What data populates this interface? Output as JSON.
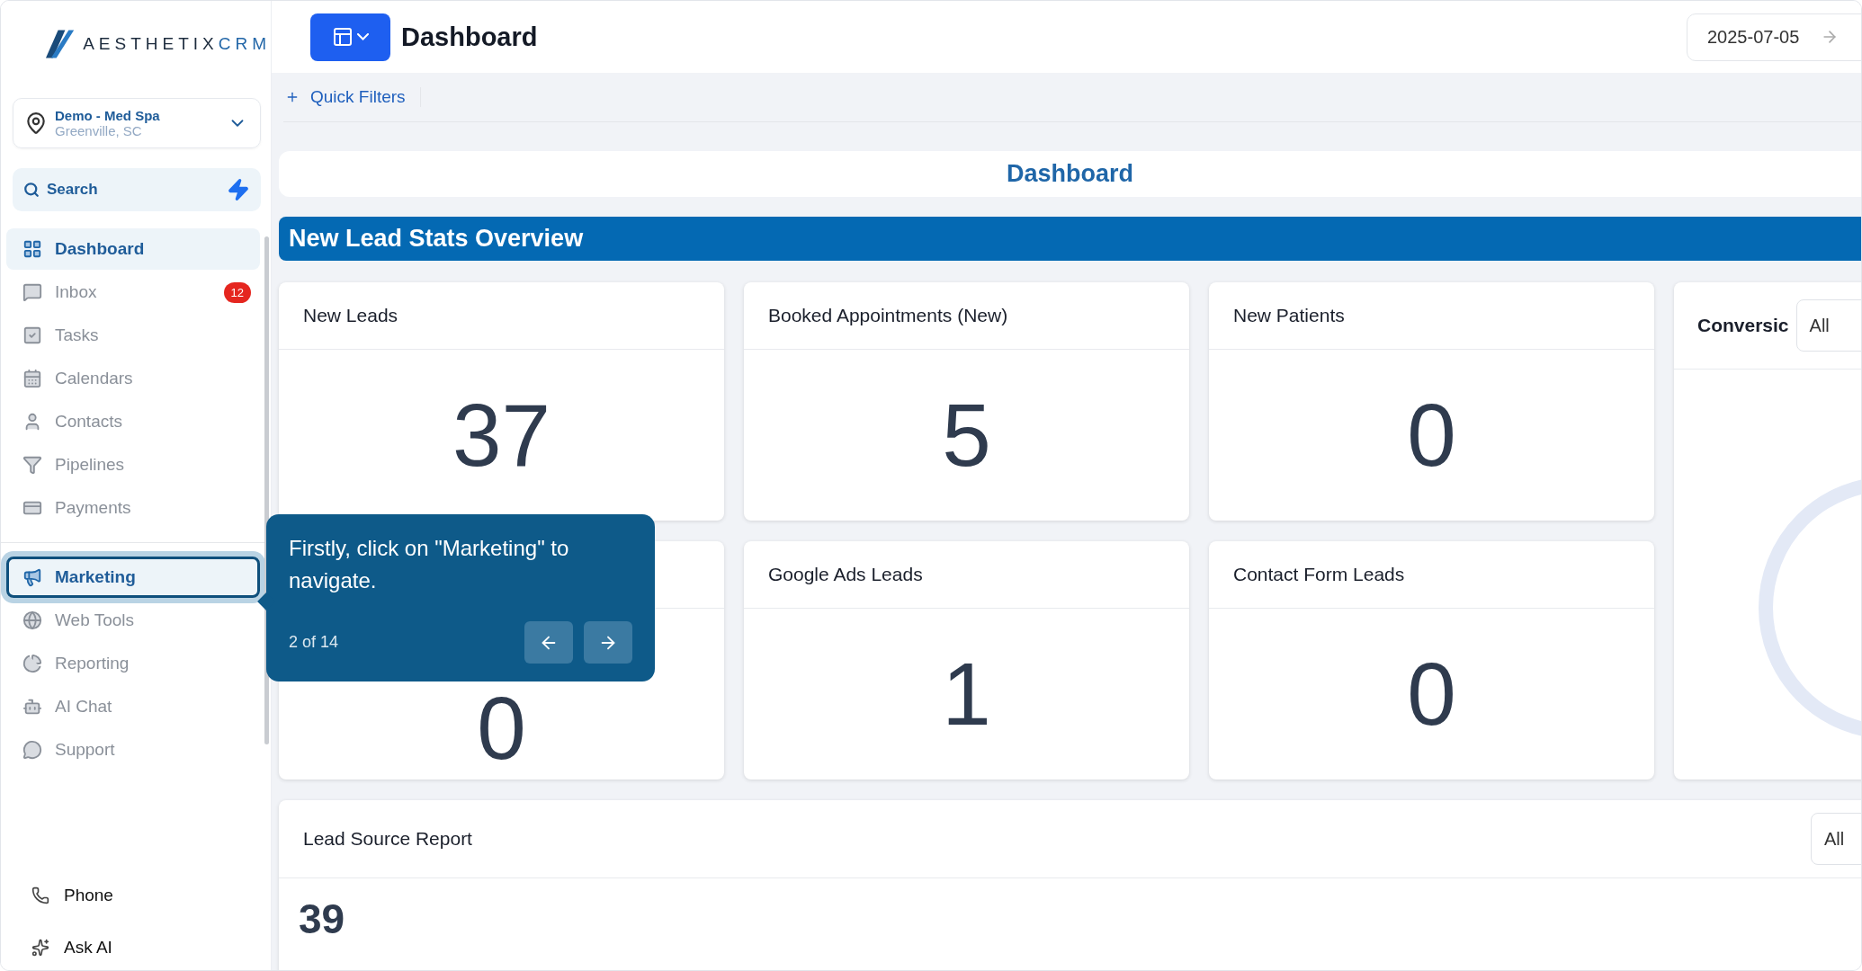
{
  "sidebar": {
    "logo": {
      "brand": "AESTHETIX",
      "suffix": "CRM"
    },
    "location": {
      "name": "Demo - Med Spa",
      "city": "Greenville, SC"
    },
    "search": {
      "placeholder": "Search"
    },
    "nav_groups": [
      [
        {
          "label": "Dashboard",
          "selected": true,
          "highlighted": false
        },
        {
          "label": "Inbox",
          "selected": false,
          "highlighted": false,
          "badge": "12"
        },
        {
          "label": "Tasks",
          "selected": false,
          "highlighted": false
        },
        {
          "label": "Calendars",
          "selected": false,
          "highlighted": false
        },
        {
          "label": "Contacts",
          "selected": false,
          "highlighted": false
        },
        {
          "label": "Pipelines",
          "selected": false,
          "highlighted": false
        },
        {
          "label": "Payments",
          "selected": false,
          "highlighted": false
        }
      ],
      [
        {
          "label": "Marketing",
          "selected": true,
          "highlighted": true
        },
        {
          "label": "Web Tools",
          "selected": false,
          "highlighted": false
        },
        {
          "label": "Reporting",
          "selected": false,
          "highlighted": false
        },
        {
          "label": "AI Chat",
          "selected": false,
          "highlighted": false
        },
        {
          "label": "Support",
          "selected": false,
          "highlighted": false
        }
      ]
    ],
    "footer": [
      {
        "label": "Phone"
      },
      {
        "label": "Ask AI"
      }
    ]
  },
  "header": {
    "title": "Dashboard",
    "date": "2025-07-05"
  },
  "filters": {
    "label": "Quick Filters"
  },
  "dashboard_title": "Dashboard",
  "section_title": "New Lead Stats Overview",
  "stat_cards": [
    {
      "title": "New Leads",
      "value": "37"
    },
    {
      "title": "Booked Appointments (New)",
      "value": "5"
    },
    {
      "title": "New Patients",
      "value": "0"
    },
    {
      "value": "0"
    },
    {
      "title": "Google Ads Leads",
      "value": "1"
    },
    {
      "title": "Contact Form Leads",
      "value": "0"
    }
  ],
  "conversion_card": {
    "title": "Conversic",
    "filter": "All"
  },
  "lead_source": {
    "title": "Lead Source Report",
    "filter": "All",
    "total": "39"
  },
  "tour_tooltip": {
    "text": "Firstly, click on \"Marketing\" to navigate.",
    "progress": "2 of 14"
  }
}
